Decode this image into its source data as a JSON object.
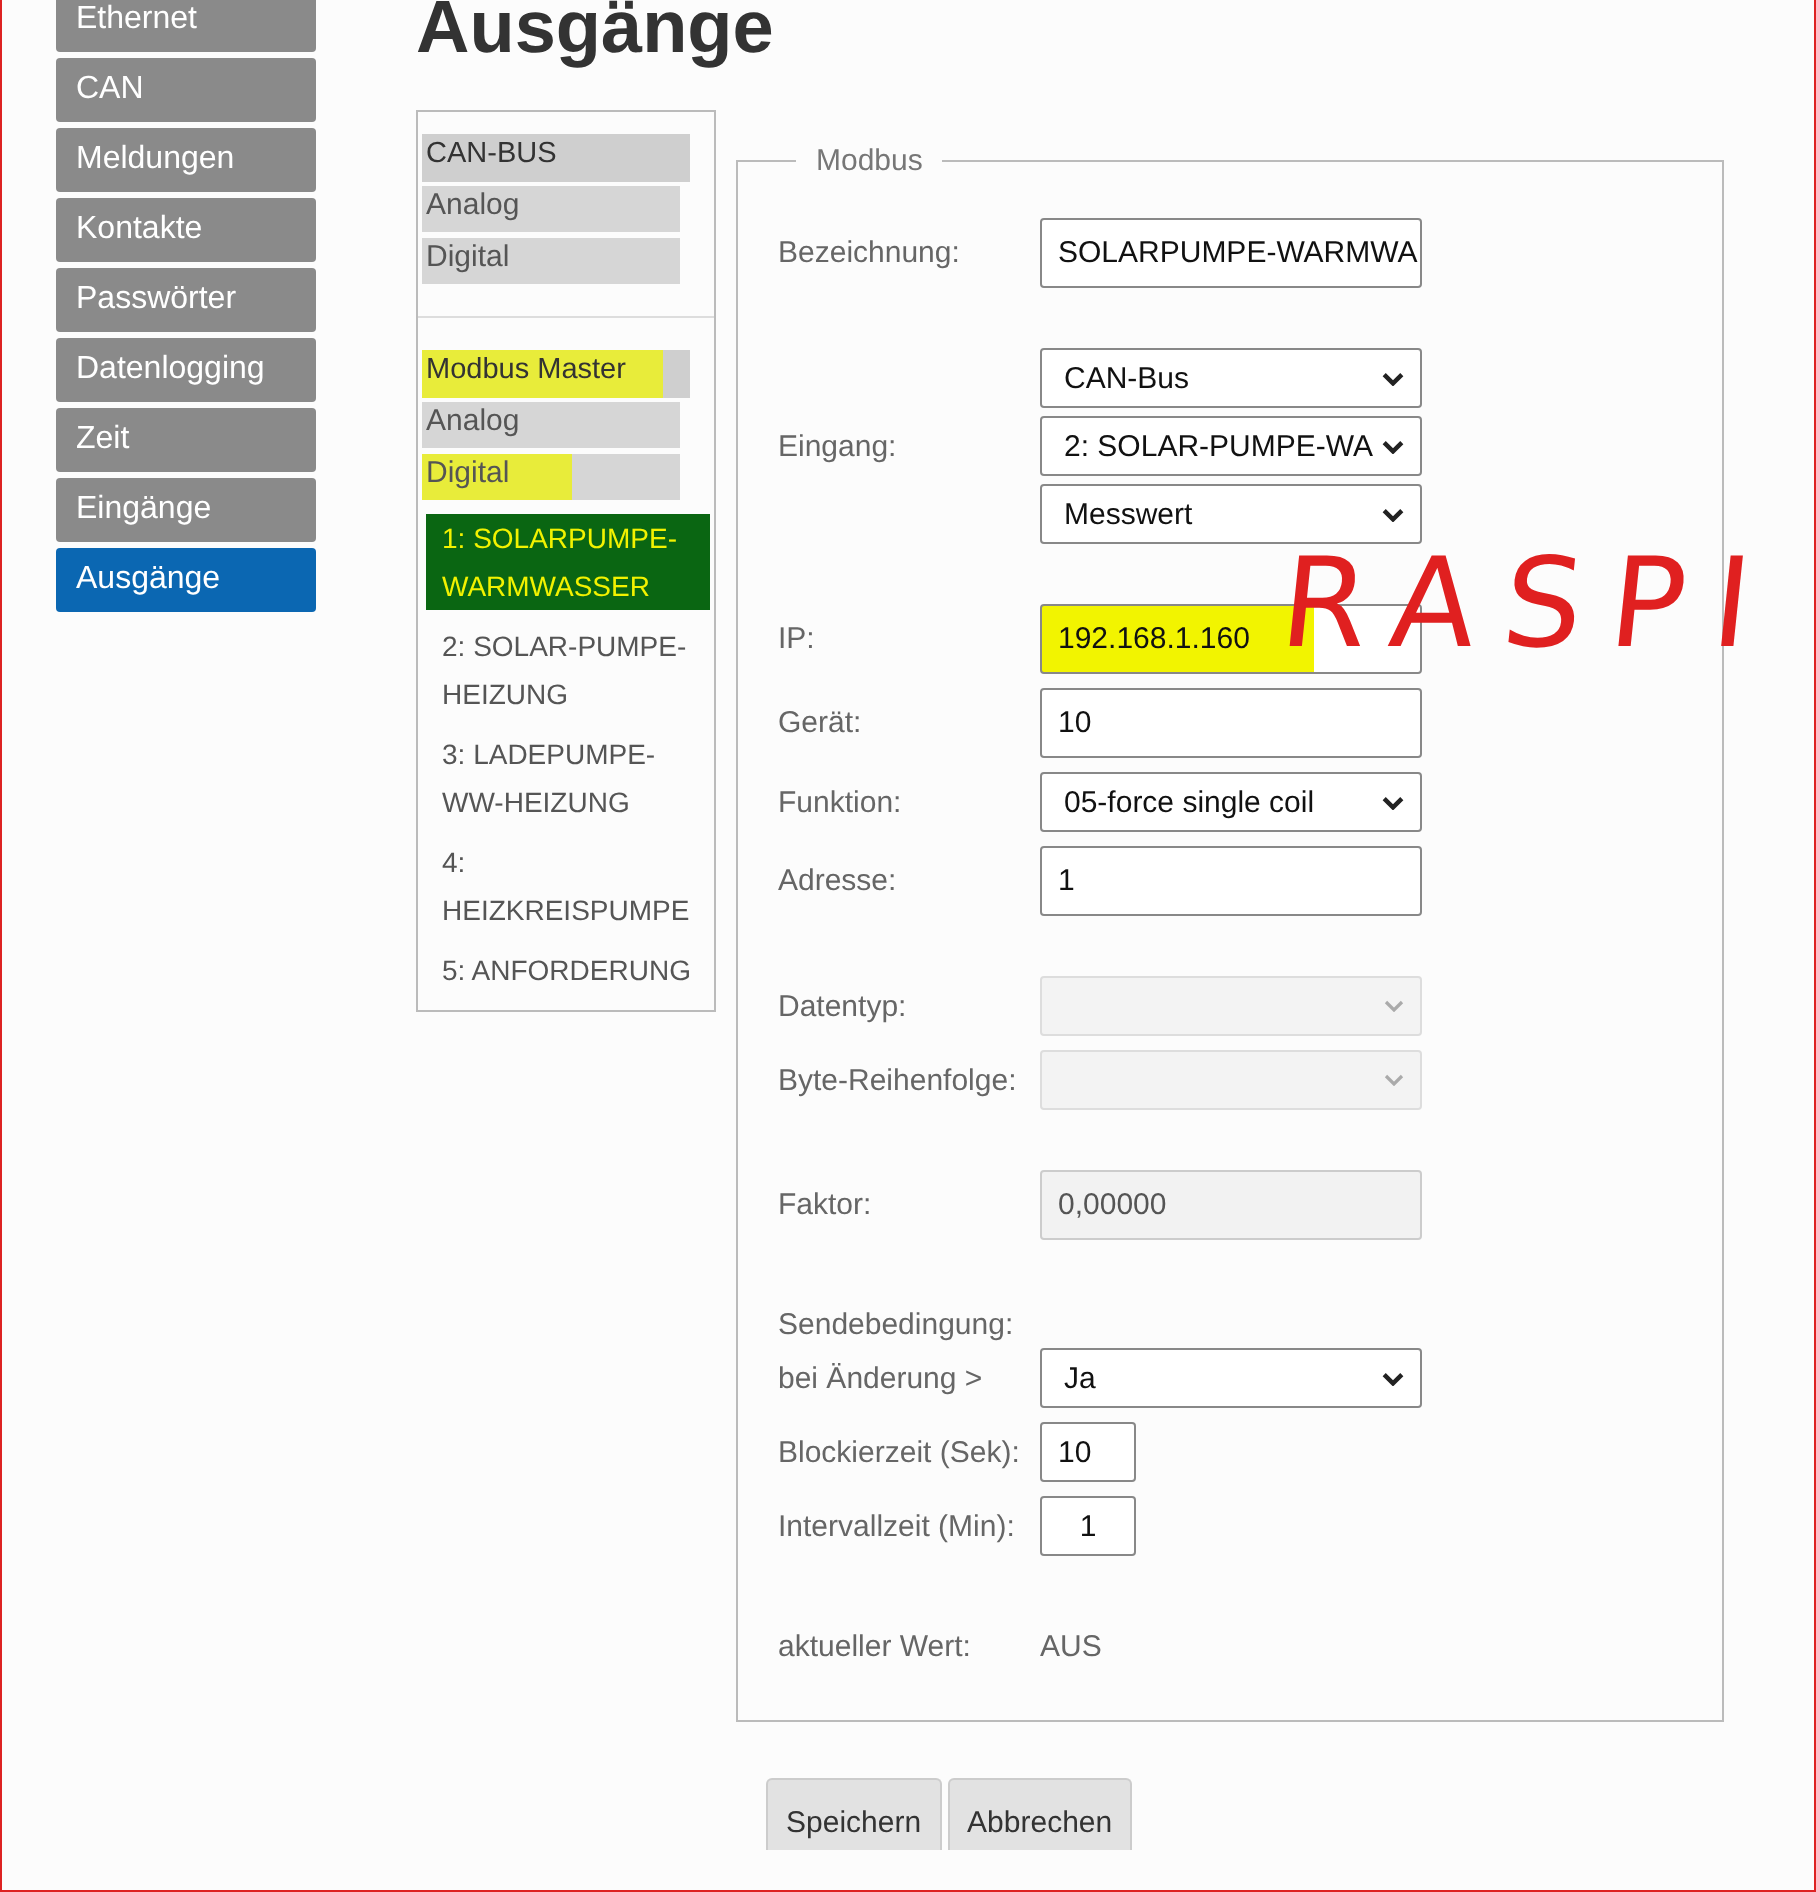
{
  "nav": [
    {
      "label": "Ethernet",
      "selected": false
    },
    {
      "label": "CAN",
      "selected": false
    },
    {
      "label": "Meldungen",
      "selected": false
    },
    {
      "label": "Kontakte",
      "selected": false
    },
    {
      "label": "Passwörter",
      "selected": false
    },
    {
      "label": "Datenlogging",
      "selected": false
    },
    {
      "label": "Zeit",
      "selected": false
    },
    {
      "label": "Eingänge",
      "selected": false
    },
    {
      "label": "Ausgänge",
      "selected": true
    }
  ],
  "page_title": "Ausgänge",
  "tree": {
    "groups": [
      {
        "title": "CAN-BUS",
        "highlighted": false,
        "items": [
          {
            "label": "Analog",
            "highlighted": false
          },
          {
            "label": "Digital",
            "highlighted": false
          }
        ]
      },
      {
        "title": "Modbus Master",
        "highlighted": true,
        "items": [
          {
            "label": "Analog",
            "highlighted": false
          },
          {
            "label": "Digital",
            "highlighted": true
          }
        ],
        "outputs": [
          {
            "label": "1: SOLARPUMPE-WARMWASSER",
            "selected": true,
            "highlighted": true
          },
          {
            "label": "2: SOLAR-PUMPE-HEIZUNG",
            "selected": false,
            "highlighted": false
          },
          {
            "label": "3: LADEPUMPE-WW-HEIZUNG",
            "selected": false,
            "highlighted": false
          },
          {
            "label": "4: HEIZKREISPUMPE",
            "selected": false,
            "highlighted": false
          },
          {
            "label": "5: ANFORDERUNG",
            "selected": false,
            "highlighted": false
          }
        ]
      }
    ]
  },
  "form": {
    "legend": "Modbus",
    "sections": [
      [
        {
          "kind": "text",
          "label": "Bezeichnung:",
          "value": "SOLARPUMPE-WARMWA",
          "highlighted": false
        }
      ],
      [
        {
          "kind": "select_stack",
          "label": "Eingang:",
          "values": [
            "CAN-Bus",
            "2: SOLAR-PUMPE-WA",
            "Messwert"
          ]
        }
      ],
      [
        {
          "kind": "text",
          "label": "IP:",
          "value": "192.168.1.160",
          "highlighted": true
        },
        {
          "kind": "text",
          "label": "Gerät:",
          "value": "10",
          "highlighted": false
        },
        {
          "kind": "select",
          "label": "Funktion:",
          "value": "05-force single coil"
        },
        {
          "kind": "text",
          "label": "Adresse:",
          "value": "1",
          "highlighted": false
        }
      ],
      [
        {
          "kind": "disabled_select",
          "label": "Datentyp:"
        },
        {
          "kind": "disabled_select",
          "label": "Byte-Reihenfolge:"
        }
      ],
      [
        {
          "kind": "disabled_text",
          "label": "Faktor:",
          "value": "0,00000"
        }
      ],
      [
        {
          "kind": "caption",
          "label": "Sendebedingung:"
        },
        {
          "kind": "select",
          "label": "bei Änderung >",
          "value": "Ja"
        },
        {
          "kind": "small_text",
          "label": "Blockierzeit (Sek):",
          "value": "10"
        },
        {
          "kind": "small_text_centered",
          "label": "Intervallzeit (Min):",
          "value": "1"
        }
      ],
      [
        {
          "kind": "readout",
          "label": "aktueller Wert:",
          "value": "AUS"
        }
      ]
    ]
  },
  "annotation": "RASPI",
  "buttons": [
    "Speichern",
    "Abbrechen"
  ]
}
